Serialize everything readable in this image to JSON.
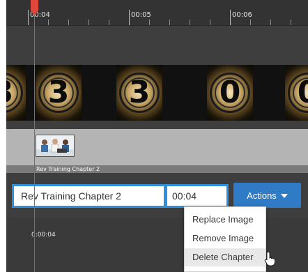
{
  "ruler": {
    "ticks": [
      {
        "label": "00:04"
      },
      {
        "label": "00:05"
      },
      {
        "label": "00:06"
      }
    ]
  },
  "filmstrip": {
    "frames": [
      {
        "digit": "3"
      },
      {
        "digit": "3"
      },
      {
        "digit": "3"
      },
      {
        "digit": "0"
      },
      {
        "digit": "0"
      }
    ]
  },
  "chapter": {
    "label": "Rev Training Chapter 2",
    "thumbnail_icon": "chapter-thumbnail-image"
  },
  "editor": {
    "name_value": "Rev Training Chapter 2",
    "time_value": "00:04",
    "actions_label": "Actions",
    "actions_icon": "caret-down-icon"
  },
  "menu": {
    "items": [
      {
        "label": "Replace Image"
      },
      {
        "label": "Remove Image"
      },
      {
        "label": "Delete Chapter"
      }
    ],
    "hovered_item": "Delete Chapter"
  },
  "playhead": {
    "time": "0:00:04",
    "color": "#e0463a"
  },
  "colors": {
    "accent": "#2f7bc6",
    "input_border": "#2f8fdc",
    "track_bg": "#3e3e3e"
  }
}
